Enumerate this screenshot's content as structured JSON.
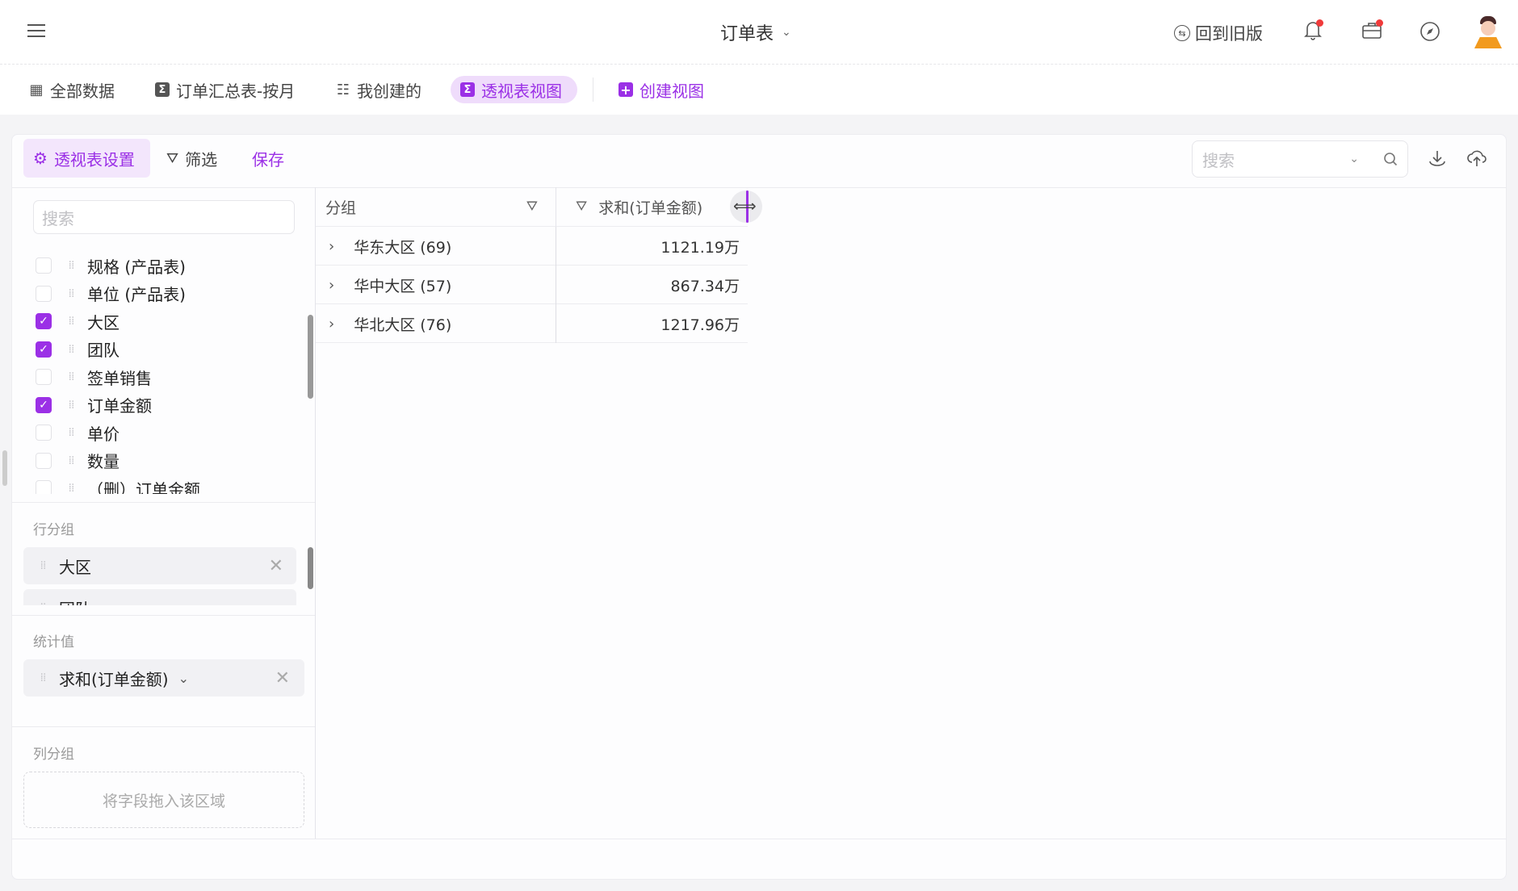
{
  "header": {
    "title": "订单表",
    "back_to_old": "回到旧版"
  },
  "tabs": [
    {
      "label": "全部数据",
      "icon": "grid-icon"
    },
    {
      "label": "订单汇总表-按月",
      "icon": "sigma-icon"
    },
    {
      "label": "我创建的",
      "icon": "list-icon"
    },
    {
      "label": "透视表视图",
      "icon": "sigma-icon",
      "active": true
    },
    {
      "label": "创建视图",
      "icon": "plus-icon"
    }
  ],
  "toolbar": {
    "pivot_settings": "透视表设置",
    "filter": "筛选",
    "save": "保存",
    "search_placeholder": "搜索"
  },
  "fields": {
    "search_placeholder": "搜索",
    "items": [
      {
        "label": "规格 (产品表)",
        "checked": false
      },
      {
        "label": "单位 (产品表)",
        "checked": false
      },
      {
        "label": "大区",
        "checked": true
      },
      {
        "label": "团队",
        "checked": true
      },
      {
        "label": "签单销售",
        "checked": false
      },
      {
        "label": "订单金额",
        "checked": true
      },
      {
        "label": "单价",
        "checked": false
      },
      {
        "label": "数量",
        "checked": false
      },
      {
        "label": "（删）订单金额",
        "checked": false
      }
    ]
  },
  "row_group": {
    "label": "行分组",
    "items": [
      "大区",
      "团队"
    ]
  },
  "values": {
    "label": "统计值",
    "items": [
      "求和(订单金额)"
    ]
  },
  "col_group": {
    "label": "列分组",
    "placeholder": "将字段拖入该区域"
  },
  "table": {
    "headers": [
      "分组",
      "求和(订单金额)"
    ],
    "rows": [
      {
        "group": "华东大区 (69)",
        "value": "1121.19万"
      },
      {
        "group": "华中大区 (57)",
        "value": "867.34万"
      },
      {
        "group": "华北大区 (76)",
        "value": "1217.96万"
      }
    ]
  },
  "colors": {
    "accent": "#9b30e6",
    "accent_bg": "#efdcfb",
    "badge": "#f03a3a"
  }
}
